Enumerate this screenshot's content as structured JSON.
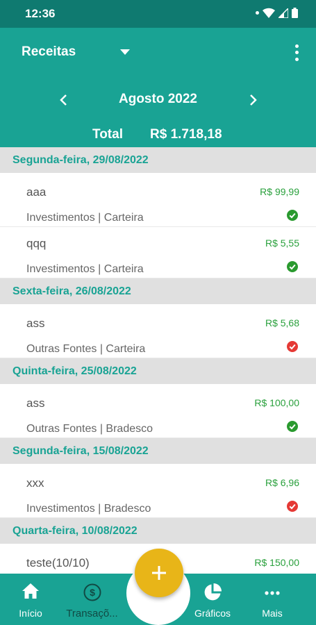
{
  "status_bar": {
    "time": "12:36"
  },
  "header": {
    "title": "Receitas",
    "month": "Agosto 2022",
    "total_label": "Total",
    "total_value": "R$ 1.718,18"
  },
  "groups": [
    {
      "date": "Segunda-feira, 29/08/2022",
      "items": [
        {
          "desc": "aaa",
          "category": "Investimentos | Carteira",
          "amount": "R$ 99,99",
          "status": "confirmed"
        },
        {
          "desc": "qqq",
          "category": "Investimentos | Carteira",
          "amount": "R$ 5,55",
          "status": "confirmed"
        }
      ]
    },
    {
      "date": "Sexta-feira, 26/08/2022",
      "items": [
        {
          "desc": "ass",
          "category": "Outras Fontes | Carteira",
          "amount": "R$ 5,68",
          "status": "pending"
        }
      ]
    },
    {
      "date": "Quinta-feira, 25/08/2022",
      "items": [
        {
          "desc": "ass",
          "category": "Outras Fontes | Bradesco",
          "amount": "R$ 100,00",
          "status": "confirmed"
        }
      ]
    },
    {
      "date": "Segunda-feira, 15/08/2022",
      "items": [
        {
          "desc": "xxx",
          "category": "Investimentos | Bradesco",
          "amount": "R$ 6,96",
          "status": "pending"
        }
      ]
    },
    {
      "date": "Quarta-feira, 10/08/2022",
      "items": [
        {
          "desc": "teste(10/10)",
          "category": "",
          "amount": "R$ 150,00",
          "status": "none"
        }
      ]
    }
  ],
  "bottom_nav": {
    "inicio": "Início",
    "transacoes": "Transaçõ...",
    "graficos": "Gráficos",
    "mais": "Mais"
  },
  "colors": {
    "primary": "#19a394",
    "status_bar": "#0f7a70",
    "amount_green": "#29a03c",
    "fab": "#e8b518",
    "confirmed": "#2a9a2f",
    "pending": "#e53935"
  }
}
